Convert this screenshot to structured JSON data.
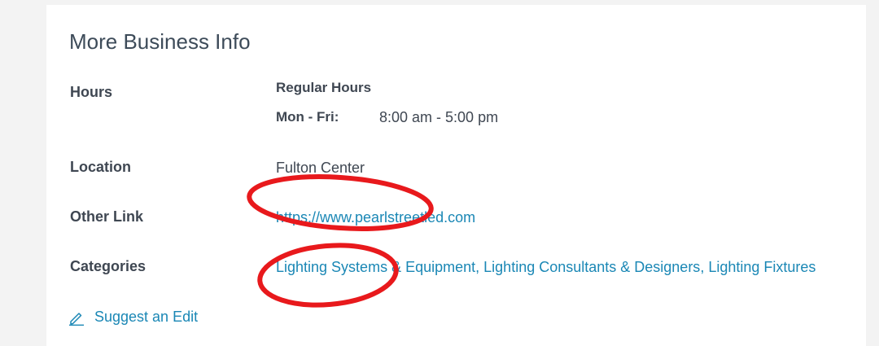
{
  "section": {
    "title": "More Business Info"
  },
  "hours": {
    "label": "Hours",
    "heading": "Regular Hours",
    "day": "Mon - Fri:",
    "time": "8:00 am - 5:00 pm"
  },
  "location": {
    "label": "Location",
    "value": "Fulton Center"
  },
  "other_link": {
    "label": "Other Link",
    "url": "https://www.pearlstreetled.com"
  },
  "categories": {
    "label": "Categories",
    "items": [
      "Lighting Systems & Equipment",
      "Lighting Consultants & Designers",
      "Lighting Fixtures"
    ],
    "separator": ", "
  },
  "suggest_edit": {
    "label": "Suggest an Edit",
    "icon": "pencil-icon"
  },
  "colors": {
    "link": "#1a87b5",
    "text": "#3f4752",
    "annotation": "#e8191c"
  }
}
